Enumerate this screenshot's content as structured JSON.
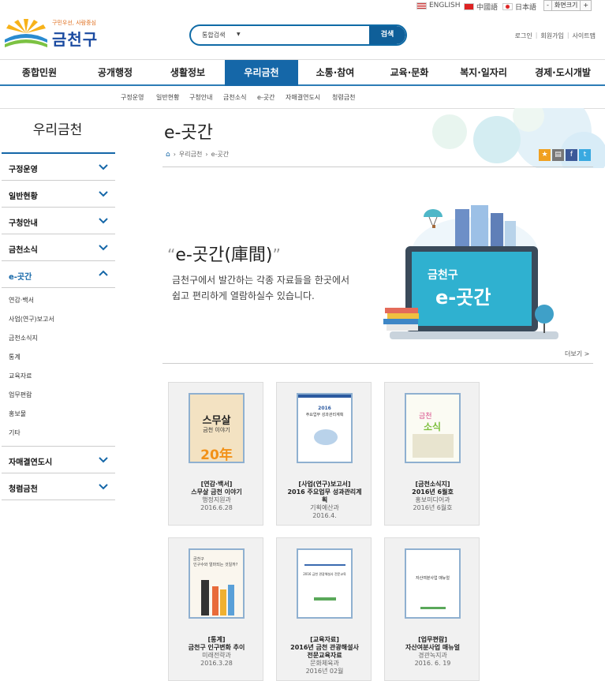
{
  "topbar": {
    "lang_en": "ENGLISH",
    "lang_cn": "中國語",
    "lang_jp": "日本語",
    "zoom_label": "화면크기",
    "zoom_minus": "-",
    "zoom_plus": "+"
  },
  "logo": {
    "tagline": "구민우선, 사람중심",
    "name": "금천구"
  },
  "search": {
    "select": "통합검색",
    "button": "검색"
  },
  "util": {
    "login": "로그인",
    "join": "회원가입",
    "sitemap": "사이트맵"
  },
  "gnb": [
    "종합민원",
    "공개행정",
    "생활정보",
    "우리금천",
    "소통·참여",
    "교육·문화",
    "복지·일자리",
    "경제·도시개발"
  ],
  "subnav": [
    "구정운영",
    "일반현황",
    "구청안내",
    "금천소식",
    "e-곳간",
    "자매결연도시",
    "청렴금천"
  ],
  "sidebar": {
    "title": "우리금천",
    "items": [
      "구정운영",
      "일반현황",
      "구청안내",
      "금천소식",
      "e-곳간"
    ],
    "subitems": [
      "연감·백서",
      "사업(연구)보고서",
      "금천소식지",
      "통계",
      "교육자료",
      "업무편람",
      "홍보물",
      "기타"
    ],
    "items_after": [
      "자매결연도시",
      "청렴금천"
    ]
  },
  "page": {
    "title": "e-곳간",
    "breadcrumb": [
      "우리금천",
      "e-곳간"
    ],
    "quote_title": "e-곳간(庫間)",
    "quote_open": "“",
    "quote_close": "”",
    "desc1": "금천구에서 발간하는 각종 자료들을 한곳에서",
    "desc2": "쉽고 편리하게 열람하실수 있습니다.",
    "screen_line1": "금천구",
    "screen_line2": "e-곳간",
    "more": "더보기 >"
  },
  "cards": [
    {
      "title1": "[연감·백서]",
      "title2": "스무살 금천 이야기",
      "dept": "행정지원과",
      "date": "2016.6.28",
      "cover1": "스무살",
      "cover2": "금천 이야기",
      "cover3": "20年"
    },
    {
      "title1": "[사업(연구)보고서]",
      "title2": "2016 주요업무 성과관리계",
      "title3": "획",
      "dept": "기획예산과",
      "date": "2016.4.",
      "cover1": "2016",
      "cover2": "주요업무 성과관리계획"
    },
    {
      "title1": "[금천소식지]",
      "title2": "2016년 6월호",
      "dept": "홍보미디어과",
      "date": "2016년 6월호",
      "cover1": "금천",
      "cover2": "소식"
    },
    {
      "title1": "[통계]",
      "title2": "금천구 인구변화 추이",
      "dept": "미래전략과",
      "date": "2016.3.28",
      "cover1": "금천구",
      "cover2": "인구수와 얼마되는 것일까?"
    },
    {
      "title1": "[교육자료]",
      "title2": "2016년 금천 관광해설사",
      "title3": "전문교육자료",
      "dept": "문화체육과",
      "date": "2016년 02월",
      "cover1": "2016 금천 관광해설사 전문교육"
    },
    {
      "title1": "[업무편람]",
      "title2": "자산여분사업 매뉴얼",
      "dept": "경관녹지과",
      "date": "2016. 6. 19",
      "cover1": "자산여분사업 매뉴얼"
    }
  ],
  "colors": {
    "primary": "#1567a8",
    "accent": "#e07020"
  }
}
